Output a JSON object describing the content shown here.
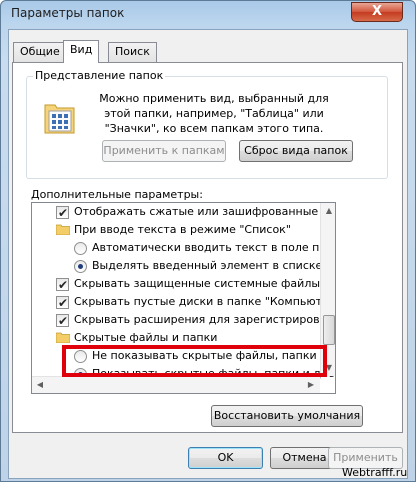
{
  "window": {
    "title": "Параметры папок",
    "close_glyph": "X"
  },
  "tabs": [
    "Общие",
    "Вид",
    "Поиск"
  ],
  "folder_view": {
    "legend": "Представление папок",
    "description": "Можно применить вид, выбранный для этой папки, например, \"Таблица\" или \"Значки\", ко всем папкам этого типа.",
    "apply_button": "Применить к папкам",
    "reset_button": "Сброс вида папок"
  },
  "advanced": {
    "label": "Дополнительные параметры:",
    "items": [
      {
        "kind": "checkbox",
        "checked": true,
        "label": "Отображать сжатые или зашифрованные файлы NTI"
      },
      {
        "kind": "folder",
        "label": "При вводе текста в режиме \"Список\""
      },
      {
        "kind": "radio",
        "checked": false,
        "label": "Автоматически вводить текст в поле поиска"
      },
      {
        "kind": "radio",
        "checked": true,
        "label": "Выделять введенный элемент в списке"
      },
      {
        "kind": "checkbox",
        "checked": true,
        "label": "Скрывать защищенные системные файлы (рекомен,"
      },
      {
        "kind": "checkbox",
        "checked": true,
        "label": "Скрывать пустые диски в папке \"Компьютер\""
      },
      {
        "kind": "checkbox",
        "checked": true,
        "label": "Скрывать расширения для зарегистрированных типо"
      },
      {
        "kind": "folder",
        "label": "Скрытые файлы и папки"
      },
      {
        "kind": "radio",
        "checked": false,
        "label": "Не показывать скрытые файлы, папки и диски"
      },
      {
        "kind": "radio",
        "checked": true,
        "label": "Показывать скрытые файлы, папки и диски"
      }
    ],
    "check_glyph": "✔"
  },
  "restore_button": "Восстановить умолчания",
  "footer": {
    "ok": "OK",
    "cancel": "Отмена",
    "apply": "Применить"
  },
  "watermark": "Webtrafff.ru",
  "scroll_arrows": {
    "up": "▲",
    "down": "▼",
    "left": "◀",
    "right": "▶"
  },
  "colors": {
    "highlight": "#e0000c",
    "radio_dot": "#203d7c",
    "title_bar": "#bcd6ee"
  }
}
